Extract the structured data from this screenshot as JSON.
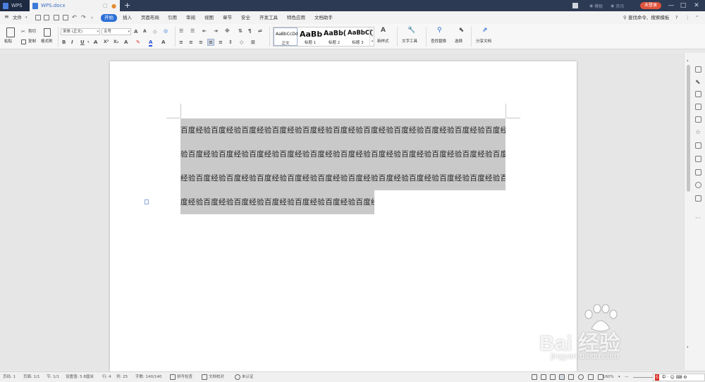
{
  "titlebar": {
    "app_tab": "WPS",
    "doc_tab": "WPS.docx",
    "add_tab": "+",
    "right_items": [
      "模板",
      "资讯"
    ],
    "login": "未登录",
    "win_controls": [
      "—",
      "□",
      "✕"
    ]
  },
  "menu": {
    "file": "文件",
    "items": [
      "开始",
      "插入",
      "页面布局",
      "引用",
      "审阅",
      "视图",
      "章节",
      "安全",
      "开发工具",
      "特色应用",
      "文档助手"
    ],
    "active": "开始",
    "search": "查找命令、搜索模板",
    "help": "?"
  },
  "ribbon": {
    "paste": "粘贴",
    "cut": "剪切",
    "copy": "复制",
    "format_painter": "格式刷",
    "font_name": "宋体 (正文)",
    "font_size": "五号",
    "bold": "B",
    "italic": "I",
    "underline": "U",
    "font_color": "A",
    "styles": [
      {
        "sample": "AaBbCcDd",
        "name": "正文"
      },
      {
        "sample": "AaBb",
        "name": "标题 1"
      },
      {
        "sample": "AaBb(",
        "name": "标题 2"
      },
      {
        "sample": "AaBbC(",
        "name": "标题 3"
      }
    ],
    "new_style": "新样式",
    "text_tools": "文字工具",
    "find_replace": "查找替换",
    "select": "选择",
    "share": "分享文档"
  },
  "document": {
    "lines": [
      "百度经验百度经验百度经验百度经验百度经验百度经验百度经验百度经验百度经验百度经验百度经",
      "验百度经验百度经验百度经验百度经验百度经验百度经验百度经验百度经验百度经验百度经验百度",
      "经验百度经验百度经验百度经验百度经验百度经验百度经验百度经验百度经验百度经验百度经验百",
      "度经验百度经验百度经验百度经验百度经验百度经验百度经验"
    ]
  },
  "status": {
    "page": "页码: 1",
    "pages": "页面: 1/1",
    "section": "节: 1/1",
    "setting": "设置值: 5.8厘米",
    "row": "行: 4",
    "col": "列: 25",
    "words": "字数: 140/140",
    "spell": "拼写检查",
    "proof": "文档校对",
    "auth": "未认证",
    "zoom": "160%",
    "zoom_minus": "—",
    "ime": [
      "S",
      "中",
      "·",
      "☺",
      "⌨",
      "⚙"
    ]
  },
  "watermark": {
    "logo_text": "Bai 经验",
    "url": "jingyan.baidu.com"
  }
}
